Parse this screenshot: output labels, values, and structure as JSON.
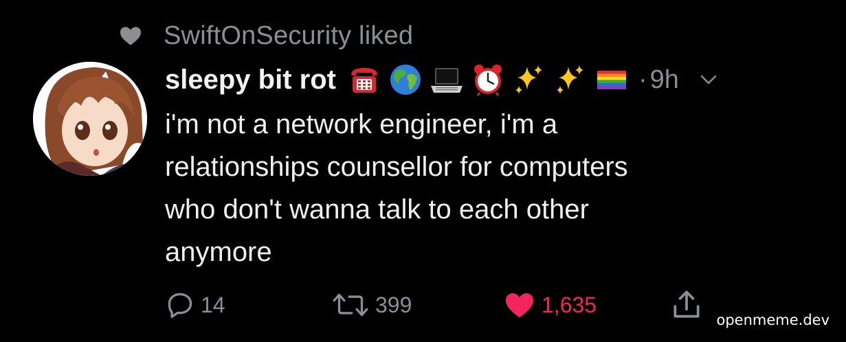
{
  "liked_banner": {
    "icon": "heart-icon",
    "text": "SwiftOnSecurity liked"
  },
  "tweet": {
    "avatar": "avatar-anime-girl",
    "display_name": "sleepy bit rot",
    "name_emojis": [
      "telephone-emoji",
      "globe-emoji",
      "laptop-emoji",
      "alarm-clock-emoji",
      "sparkles-emoji",
      "sparkles-emoji",
      "rainbow-flag-emoji"
    ],
    "separator": "·",
    "time": "9h",
    "menu_icon": "chevron-down-icon",
    "text_lines": [
      "i'm not a network engineer, i'm a",
      "relationships counsellor for computers",
      "who don't wanna talk to each other",
      "anymore"
    ]
  },
  "actions": {
    "reply": {
      "icon": "reply-icon",
      "count": "14"
    },
    "retweet": {
      "icon": "retweet-icon",
      "count": "399"
    },
    "like": {
      "icon": "heart-filled-icon",
      "count": "1,635",
      "active": true
    },
    "share": {
      "icon": "share-icon"
    }
  },
  "watermark": "openmeme.dev",
  "colors": {
    "background": "#000000",
    "text": "#f0f0f0",
    "muted": "#8b8f93",
    "like": "#f4245e"
  }
}
